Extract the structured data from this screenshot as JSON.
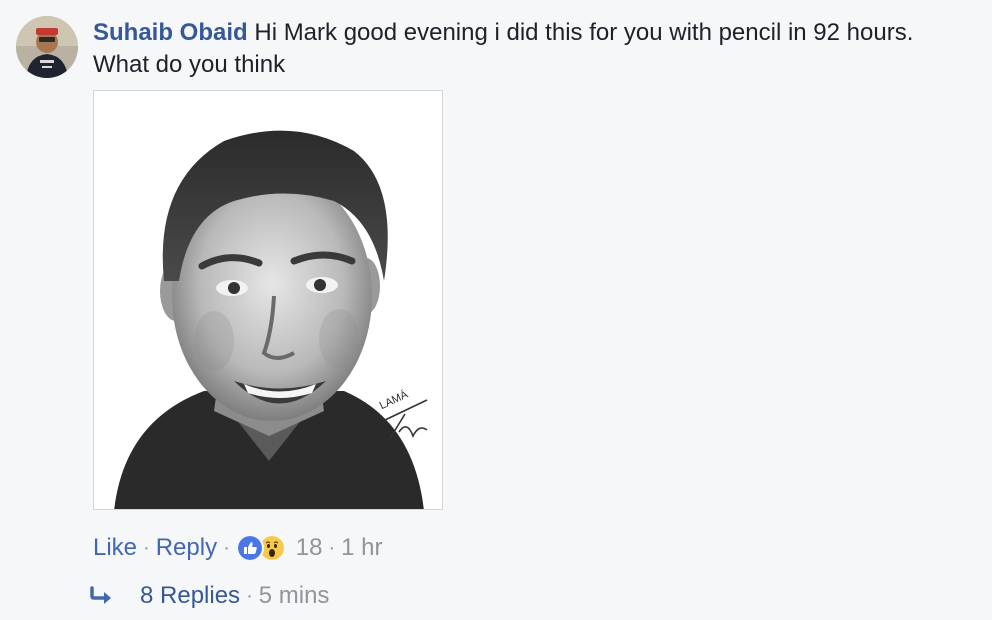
{
  "comment": {
    "author": "Suhaib Obaid",
    "text": "Hi Mark good evening i did this for you with pencil in 92 hours. What do you think",
    "avatar_icon": "profile-photo"
  },
  "attachment": {
    "description_icon": "pencil-portrait-drawing",
    "signature_text": "LAMÁ"
  },
  "actions": {
    "like_label": "Like",
    "reply_label": "Reply",
    "separator": "·",
    "reaction_icons": [
      "like-reaction-icon",
      "wow-reaction-icon"
    ],
    "reaction_count": "18",
    "timestamp": "1 hr"
  },
  "replies": {
    "label": "8 Replies",
    "timestamp": "5 mins",
    "icon": "reply-arrow-icon"
  },
  "colors": {
    "link_blue": "#4267b2",
    "author_blue": "#365899",
    "meta_gray": "#90949c",
    "background": "#f6f7f9"
  }
}
